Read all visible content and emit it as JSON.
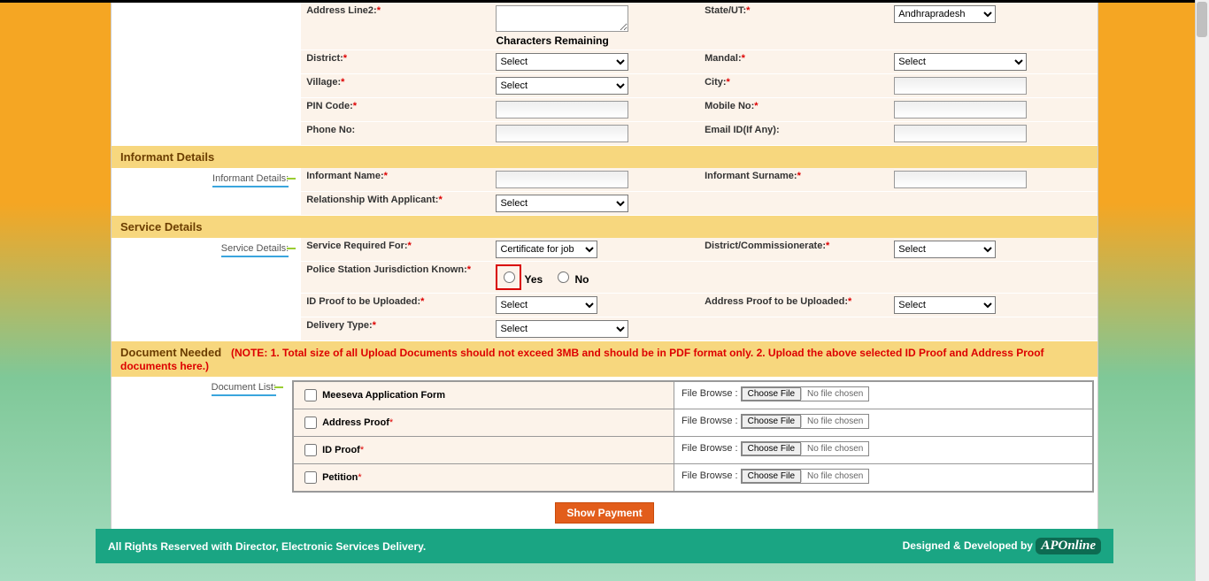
{
  "fields": {
    "address2": {
      "label": "Address Line2:",
      "chars": "Characters Remaining"
    },
    "state": {
      "label": "State/UT:",
      "value": "Andhrapradesh"
    },
    "district": {
      "label": "District:",
      "value": "Select"
    },
    "mandal": {
      "label": "Mandal:",
      "value": "Select"
    },
    "village": {
      "label": "Village:",
      "value": "Select"
    },
    "city": {
      "label": "City:"
    },
    "pincode": {
      "label": "PIN Code:"
    },
    "mobile": {
      "label": "Mobile No:"
    },
    "phone": {
      "label": "Phone No:"
    },
    "email": {
      "label": "Email ID(If Any):"
    }
  },
  "informant": {
    "section": "Informant Details",
    "sidebar": "Informant Details:",
    "name": {
      "label": "Informant Name:"
    },
    "surname": {
      "label": "Informant Surname:"
    },
    "relationship": {
      "label": "Relationship With Applicant:",
      "value": "Select"
    }
  },
  "service": {
    "section": "Service Details",
    "sidebar": "Service Details:",
    "required_for": {
      "label": "Service Required For:",
      "value": "Certificate for job"
    },
    "commissionerate": {
      "label": "District/Commissionerate:",
      "value": "Select"
    },
    "ps_known": {
      "label": "Police Station Jurisdiction Known:",
      "yes": "Yes",
      "no": "No"
    },
    "id_proof": {
      "label": "ID Proof to be Uploaded:",
      "value": "Select"
    },
    "addr_proof": {
      "label": "Address Proof to be Uploaded:",
      "value": "Select"
    },
    "delivery": {
      "label": "Delivery Type:",
      "value": "Select"
    }
  },
  "documents": {
    "section": "Document Needed",
    "note": "(NOTE: 1. Total size of all Upload Documents should not exceed 3MB and should be in PDF format only. 2. Upload the above selected ID Proof and Address Proof documents here.)",
    "sidebar": "Document List:",
    "browse": "File Browse :",
    "choose": "Choose File",
    "nofile": "No file chosen",
    "items": {
      "d0": "Meeseva Application Form",
      "d1": "Address Proof",
      "d2": "ID Proof",
      "d3": "Petition"
    }
  },
  "buttons": {
    "show_payment": "Show Payment"
  },
  "footer": {
    "left": "All Rights Reserved with Director, Electronic Services Delivery.",
    "right": "Designed & Developed by",
    "logo": "APOnline"
  }
}
